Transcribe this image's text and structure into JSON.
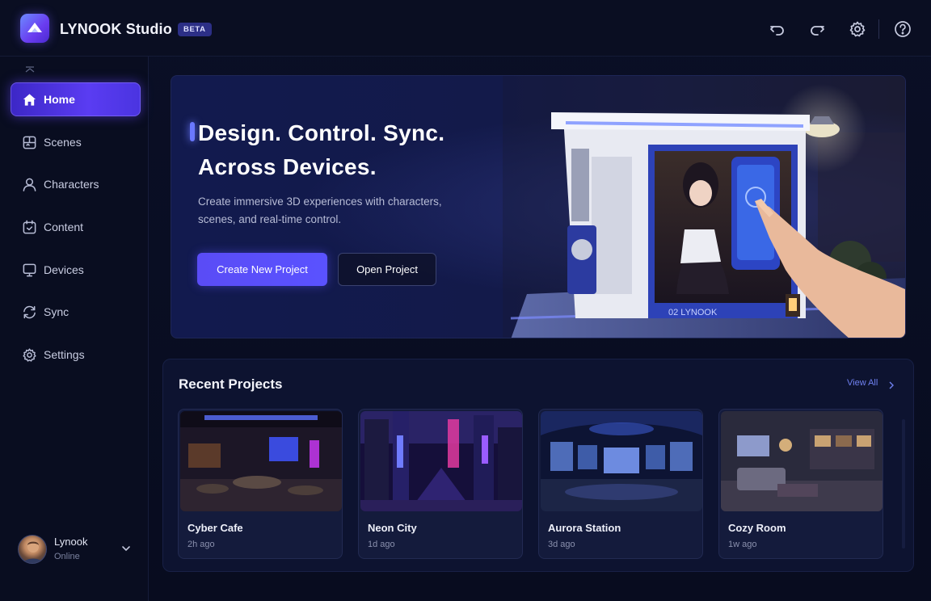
{
  "app": {
    "name": "LYNOOK Studio",
    "badge": "BETA"
  },
  "toolbar": {
    "icons": [
      "undo-icon",
      "redo-icon",
      "gear-icon",
      "help-icon"
    ]
  },
  "sidebar": {
    "items": [
      {
        "label": "Home",
        "icon": "home-icon",
        "active": true
      },
      {
        "label": "Scenes",
        "icon": "scenes-icon"
      },
      {
        "label": "Characters",
        "icon": "user-icon"
      },
      {
        "label": "Content",
        "icon": "content-icon"
      },
      {
        "label": "Devices",
        "icon": "monitor-icon"
      },
      {
        "label": "Sync",
        "icon": "sync-icon"
      },
      {
        "label": "Settings",
        "icon": "gear-icon"
      }
    ],
    "profile": {
      "name": "Lynook",
      "status": "Online"
    }
  },
  "hero": {
    "title_line1": "Design. Control. Sync.",
    "title_line2": "Across Devices.",
    "subtitle_line1": "Create immersive 3D experiences with characters,",
    "subtitle_line2": "scenes, and real-time control.",
    "primary_button": "Create New Project",
    "secondary_button": "Open Project",
    "device_label": "02 LYNOOK"
  },
  "recent": {
    "title": "Recent Projects",
    "view_all": "View All",
    "projects": [
      {
        "name": "Cyber Cafe",
        "time": "2h ago"
      },
      {
        "name": "Neon City",
        "time": "1d ago"
      },
      {
        "name": "Aurora Station",
        "time": "3d ago"
      },
      {
        "name": "Cozy Room",
        "time": "1w ago"
      }
    ]
  },
  "colors": {
    "accent": "#5a4cf6",
    "background": "#0a0e22",
    "panel": "#0d1330"
  }
}
